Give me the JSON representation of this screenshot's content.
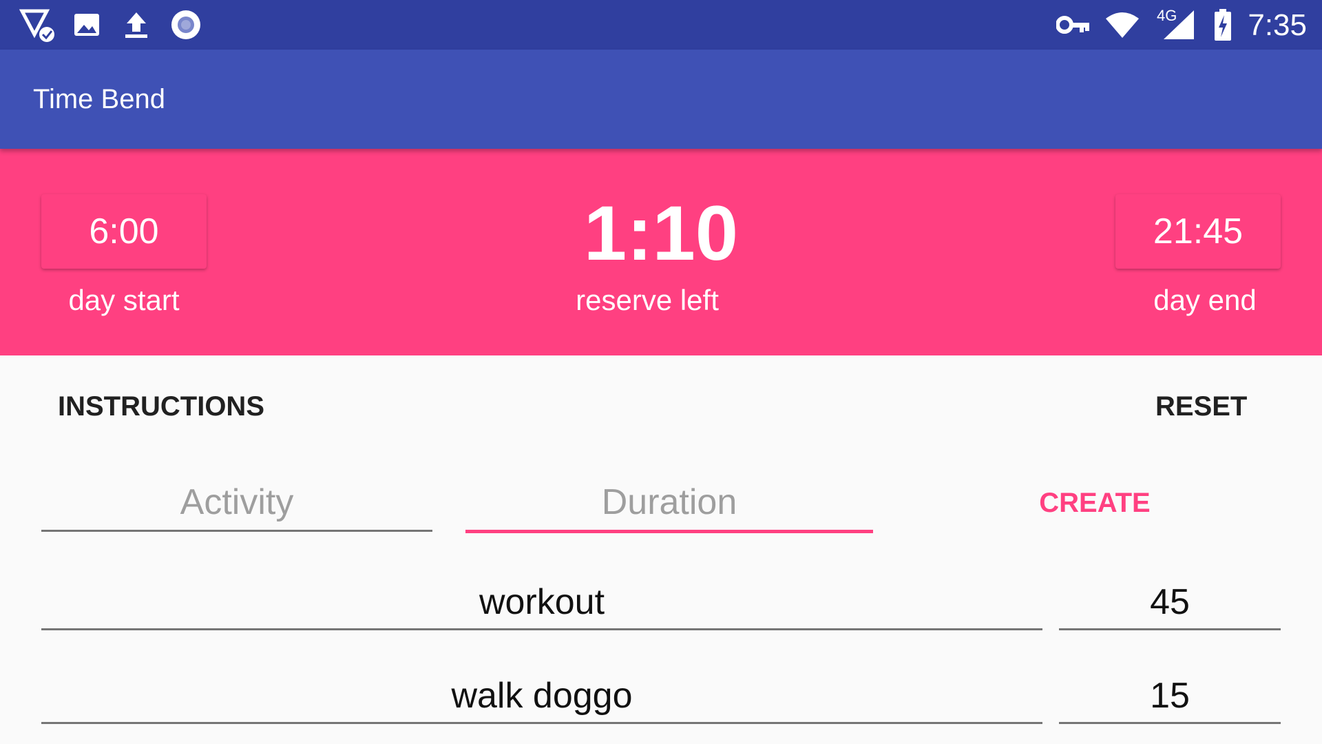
{
  "status_bar": {
    "time": "7:35",
    "network_badge": "4G",
    "icons": [
      "signal-check-icon",
      "image-icon",
      "upload-icon",
      "circle-record-icon",
      "vpn-key-icon",
      "wifi-icon",
      "cell-signal-icon",
      "battery-charging-icon"
    ]
  },
  "app_bar": {
    "title": "Time Bend"
  },
  "banner": {
    "day_start": {
      "value": "6:00",
      "label": "day start"
    },
    "reserve": {
      "value": "1:10",
      "label": "reserve left"
    },
    "day_end": {
      "value": "21:45",
      "label": "day end"
    }
  },
  "actions": {
    "instructions": "INSTRUCTIONS",
    "reset": "RESET"
  },
  "form": {
    "activity_placeholder": "Activity",
    "duration_placeholder": "Duration",
    "create_label": "CREATE"
  },
  "activities": [
    {
      "name": "workout",
      "duration": "45"
    },
    {
      "name": "walk doggo",
      "duration": "15"
    }
  ],
  "colors": {
    "status_bar": "#303f9f",
    "app_bar": "#3f51b5",
    "accent": "#ff4081",
    "background": "#fafafa"
  }
}
